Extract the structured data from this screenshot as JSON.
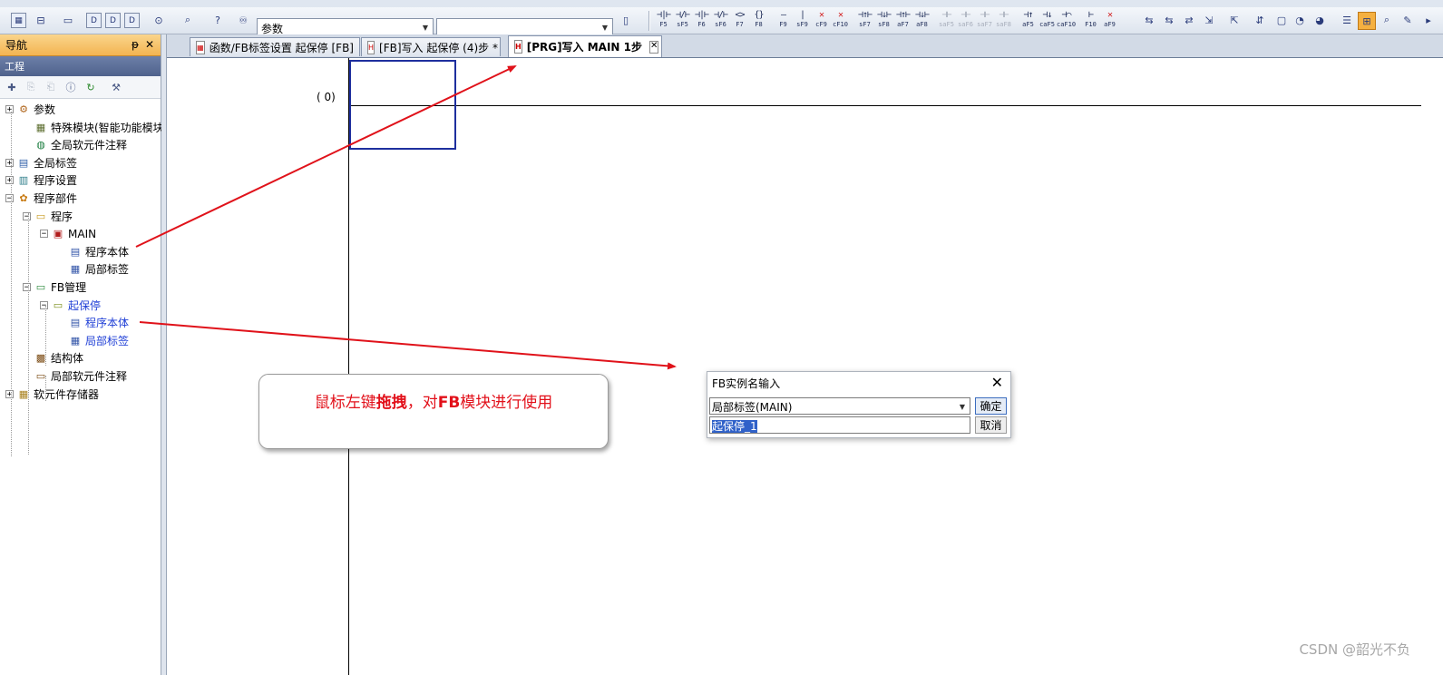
{
  "toolbar": {
    "param_combo": "参数",
    "ladder_buttons": [
      {
        "sym": "⊣|⊢",
        "lbl": "F5"
      },
      {
        "sym": "⊣/⊢",
        "lbl": "sF5"
      },
      {
        "sym": "⊣|⊢",
        "lbl": "F6"
      },
      {
        "sym": "⊣/⊢",
        "lbl": "sF6"
      },
      {
        "sym": "<>",
        "lbl": "F7"
      },
      {
        "sym": "{}",
        "lbl": "F8"
      },
      {
        "sym": "—",
        "lbl": "F9"
      },
      {
        "sym": "|",
        "lbl": "sF9"
      },
      {
        "sym": "✕",
        "lbl": "cF9"
      },
      {
        "sym": "✕",
        "lbl": "cF10"
      },
      {
        "sym": "⊣↑⊢",
        "lbl": "sF7"
      },
      {
        "sym": "⊣↓⊢",
        "lbl": "sF8"
      },
      {
        "sym": "⊣↑⊢",
        "lbl": "aF7"
      },
      {
        "sym": "⊣↓⊢",
        "lbl": "aF8"
      },
      {
        "sym": "⊣⊢",
        "lbl": "saF5"
      },
      {
        "sym": "⊣⊢",
        "lbl": "saF6"
      },
      {
        "sym": "⊣⊢",
        "lbl": "saF7"
      },
      {
        "sym": "⊣⊢",
        "lbl": "saF8"
      },
      {
        "sym": "⊣↑",
        "lbl": "aF5"
      },
      {
        "sym": "⊣↓",
        "lbl": "caF5"
      },
      {
        "sym": "⊣⌒",
        "lbl": "caF10"
      },
      {
        "sym": "⊢",
        "lbl": "F10"
      },
      {
        "sym": "✕",
        "lbl": "aF9"
      }
    ]
  },
  "nav": {
    "title": "导航",
    "pin": "ᵽ",
    "close": "✕",
    "project_label": "工程",
    "tree": [
      {
        "label": "参数",
        "expander": "+",
        "icon": "⚙",
        "blue": false
      },
      {
        "label": "特殊模块(智能功能模块)",
        "expander": "",
        "icon": "▦",
        "blue": false
      },
      {
        "label": "全局软元件注释",
        "expander": "",
        "icon": "◍",
        "blue": false
      },
      {
        "label": "全局标签",
        "expander": "+",
        "icon": "▤",
        "blue": false
      },
      {
        "label": "程序设置",
        "expander": "+",
        "icon": "▥",
        "blue": false
      },
      {
        "label": "程序部件",
        "expander": "−",
        "icon": "✿",
        "blue": false
      },
      {
        "label": "程序",
        "expander": "−",
        "icon": "▭",
        "blue": false
      },
      {
        "label": "MAIN",
        "expander": "−",
        "icon": "▣",
        "blue": false
      },
      {
        "label": "程序本体",
        "expander": "",
        "icon": "▤",
        "blue": false
      },
      {
        "label": "局部标签",
        "expander": "",
        "icon": "▦",
        "blue": false
      },
      {
        "label": "FB管理",
        "expander": "−",
        "icon": "▭",
        "blue": false
      },
      {
        "label": "起保停",
        "expander": "−",
        "icon": "▭",
        "blue": true
      },
      {
        "label": "程序本体",
        "expander": "",
        "icon": "▤",
        "blue": true
      },
      {
        "label": "局部标签",
        "expander": "",
        "icon": "▦",
        "blue": true
      },
      {
        "label": "结构体",
        "expander": "",
        "icon": "▩",
        "blue": false
      },
      {
        "label": "局部软元件注释",
        "expander": "",
        "icon": "▭",
        "blue": false
      },
      {
        "label": "软元件存储器",
        "expander": "+",
        "icon": "▦",
        "blue": false
      }
    ]
  },
  "tabs": [
    {
      "label": "函数/FB标签设置 起保停 [FB]"
    },
    {
      "label": "[FB]写入 起保停 (4)步 *"
    },
    {
      "label": "[PRG]写入 MAIN 1步"
    }
  ],
  "editor": {
    "step_label": "(    0)"
  },
  "callout": {
    "part1": "鼠标左键",
    "part2": "拖拽",
    "part3": "，对",
    "part4": "FB",
    "part5": "模块进行使用"
  },
  "dialog": {
    "title": "FB实例名输入",
    "close": "✕",
    "scope_value": "局部标签(MAIN)",
    "instance_name": "起保停_1",
    "ok_label": "确定",
    "cancel_label": "取消"
  },
  "watermark": "CSDN @韶光不负",
  "colors": {
    "arrow": "#e0121a",
    "callout_text": "#e2101a",
    "cursor_box": "#1e2f9e",
    "nav_header": "#f3b451"
  }
}
